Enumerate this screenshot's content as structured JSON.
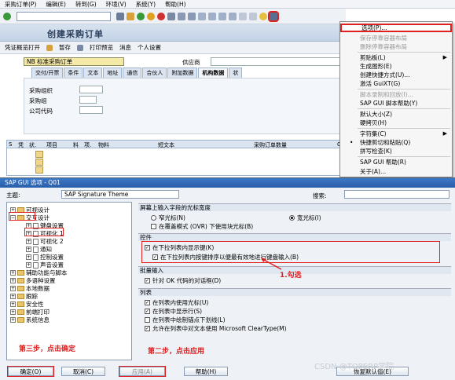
{
  "menubar": {
    "items": [
      "采购订单(P)",
      "编辑(E)",
      "转到(G)",
      "环境(V)",
      "系统(Y)",
      "帮助(H)"
    ]
  },
  "appbar": {
    "items": [
      "凭证概览打开",
      "暂存",
      "打印预览",
      "消息",
      "个人设置"
    ]
  },
  "screen": {
    "title": "创建采购订单",
    "order_type": "NB 标准采购订单",
    "vendor_label": "供应商"
  },
  "tabs": [
    "交付/开票",
    "条件",
    "文本",
    "地址",
    "通信",
    "合伙人",
    "附加数据",
    "机构数据",
    "状"
  ],
  "form": {
    "fields": [
      "采购组织",
      "采购组",
      "公司代码"
    ]
  },
  "grid": {
    "headers": [
      "S",
      "凭",
      "状.",
      "项目",
      "料",
      "项.",
      "物料",
      "短文本",
      "采购订单数量",
      "O"
    ]
  },
  "context_menu": {
    "items": [
      {
        "label": "选项(P)...",
        "disabled": false,
        "highlighted": true
      },
      {
        "label": "保存停靠容器布局",
        "disabled": true
      },
      {
        "label": "删除停靠容器布局",
        "disabled": true
      },
      {
        "label": "剪贴板(L)",
        "disabled": false,
        "submenu": true
      },
      {
        "label": "生成图形(E)",
        "disabled": false
      },
      {
        "label": "创建快捷方式(U)...",
        "disabled": false
      },
      {
        "label": "激活 GuiXT(G)",
        "disabled": false
      },
      {
        "label": "脚本录制和回放(I)...",
        "disabled": true
      },
      {
        "label": "SAP GUI 脚本帮助(Y)",
        "disabled": false
      },
      {
        "label": "默认大小(Z)",
        "disabled": false
      },
      {
        "label": "硬拷贝(H)",
        "disabled": false
      },
      {
        "label": "字符集(C)",
        "disabled": false,
        "submenu": true
      },
      {
        "label": "快捷剪切和粘贴(Q)",
        "disabled": false
      },
      {
        "label": "拼写检查(K)",
        "disabled": false
      },
      {
        "label": "SAP GUI 帮助(R)",
        "disabled": false
      },
      {
        "label": "关于(A)...",
        "disabled": false
      }
    ]
  },
  "dialog": {
    "title": "SAP GUI 选项 - Q01",
    "theme_label": "主题:",
    "theme_value": "SAP Signature Theme",
    "search_label": "搜索:",
    "tree": [
      {
        "label": "可视设计",
        "expand": "+",
        "level": 0
      },
      {
        "label": "交互设计",
        "expand": "-",
        "level": 0
      },
      {
        "label": "键盘设置",
        "level": 1
      },
      {
        "label": "可视化 1",
        "level": 1
      },
      {
        "label": "可视化 2",
        "level": 1
      },
      {
        "label": "通知",
        "level": 1
      },
      {
        "label": "控制设置",
        "level": 1
      },
      {
        "label": "声音设置",
        "level": 1
      },
      {
        "label": "辅助功能与脚本",
        "expand": "+",
        "level": 0
      },
      {
        "label": "多语种设置",
        "expand": "+",
        "level": 0
      },
      {
        "label": "本地数据",
        "expand": "+",
        "level": 0
      },
      {
        "label": "跟踪",
        "expand": "+",
        "level": 0
      },
      {
        "label": "安全性",
        "expand": "+",
        "level": 0
      },
      {
        "label": "前端打印",
        "expand": "+",
        "level": 0
      },
      {
        "label": "系统信息",
        "expand": "+",
        "level": 0
      }
    ],
    "cursor_section": "屏幕上输入字段的光标宽度",
    "cursor_narrow": "窄光标(N)",
    "cursor_wide": "宽光标(I)",
    "cursor_overwrite": "在覆盖模式 (OVR) 下使用块光标(B)",
    "controls_section": "控件",
    "control_opt1": "在下拉列表内显示键(K)",
    "control_opt2": "在下拉列表内按键排序以便最有效地进行键盘输入(B)",
    "batch_section": "批量输入",
    "batch_opt": "针对 OK 代码的对话框(D)",
    "list_section": "列表",
    "list_opt1": "在列表内使用光标(U)",
    "list_opt2": "在列表中显示行(S)",
    "list_opt3": "在列表中绘制锚点下划线(L)",
    "list_opt4": "允许在列表中对文本使用 Microsoft ClearType(M)",
    "buttons": {
      "ok": "确定(O)",
      "cancel": "取消(C)",
      "apply": "应用(A)",
      "help": "帮助(H)",
      "restore": "恢复默认值(E)"
    }
  },
  "annotations": {
    "step1": "1.勾选",
    "step2": "第二步，点击应用",
    "step3": "第三步，点击确定"
  },
  "watermark": "CSDN @TOPERP学院",
  "colors": {
    "accent_red": "#e02020",
    "title_blue": "#2a5fa8",
    "field_yellow": "#f5e9a8"
  }
}
